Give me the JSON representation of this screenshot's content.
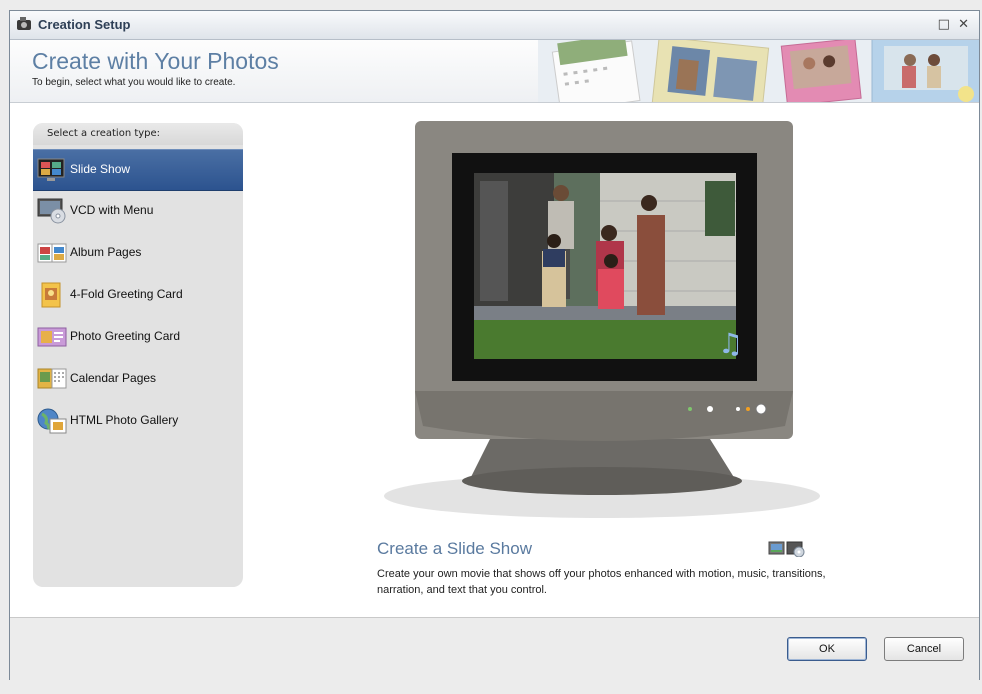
{
  "window": {
    "title": "Creation Setup",
    "restore_glyph": "□",
    "close_glyph": "✕"
  },
  "header": {
    "title": "Create with Your Photos",
    "subtitle": "To begin, select what you would like to create."
  },
  "sidebar": {
    "heading": "Select a creation type:",
    "selected_index": 0,
    "items": [
      {
        "label": "Slide Show",
        "icon": "slideshow-icon"
      },
      {
        "label": "VCD with Menu",
        "icon": "vcd-disc-icon"
      },
      {
        "label": "Album Pages",
        "icon": "album-pages-icon"
      },
      {
        "label": "4-Fold Greeting Card",
        "icon": "greeting-card-icon"
      },
      {
        "label": "Photo Greeting Card",
        "icon": "photo-card-icon"
      },
      {
        "label": "Calendar Pages",
        "icon": "calendar-icon"
      },
      {
        "label": "HTML Photo Gallery",
        "icon": "web-gallery-icon"
      }
    ]
  },
  "description": {
    "title": "Create a Slide Show",
    "text": "Create your own movie that shows off your photos enhanced with motion, music, transitions, narration, and text that you control.",
    "icons": [
      "photo-output-icon",
      "disc-output-icon"
    ]
  },
  "footer": {
    "ok_label": "OK",
    "cancel_label": "Cancel"
  },
  "colors": {
    "accent": "#5d7fa4",
    "selection": "#2c538f"
  }
}
